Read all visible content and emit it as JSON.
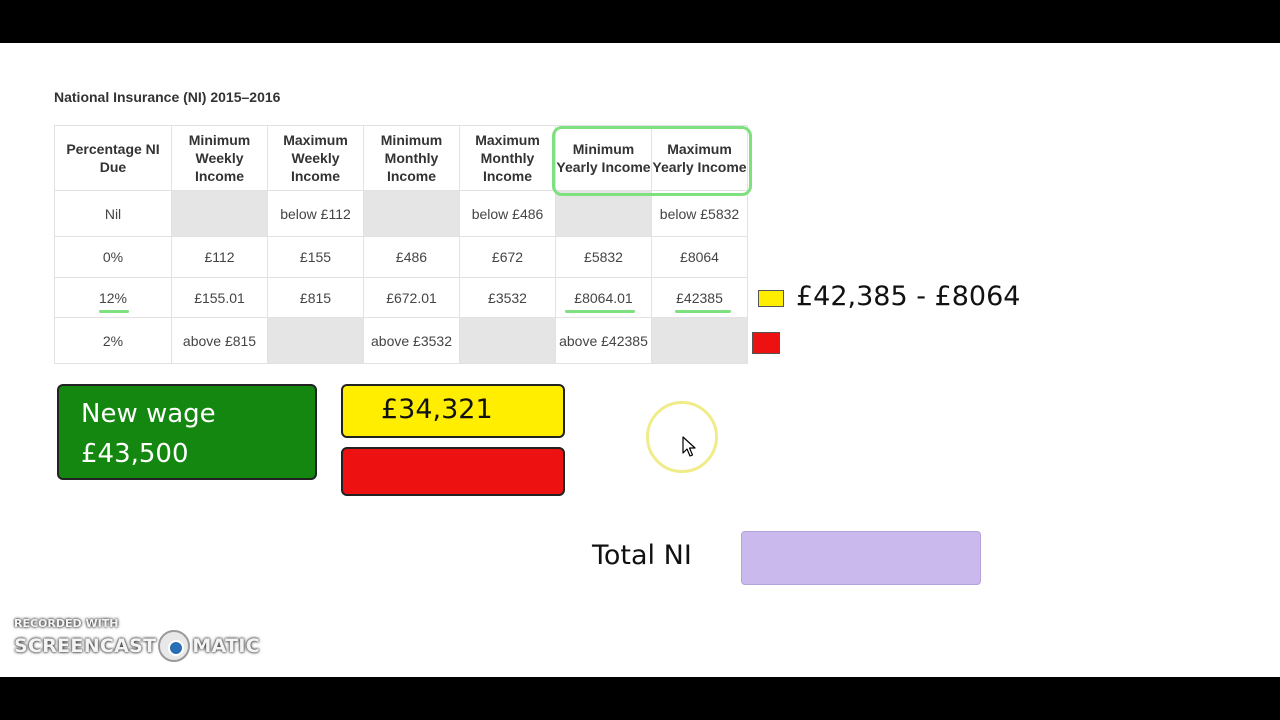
{
  "title": "National Insurance (NI) 2015–2016",
  "table": {
    "headers": [
      "Percentage NI Due",
      "Minimum Weekly Income",
      "Maximum Weekly Income",
      "Minimum Monthly Income",
      "Maximum Monthly Income",
      "Minimum Yearly Income",
      "Maximum Yearly Income"
    ],
    "rows": [
      [
        "Nil",
        "",
        "below £112",
        "",
        "below £486",
        "",
        "below £5832"
      ],
      [
        "0%",
        "£112",
        "£155",
        "£486",
        "£672",
        "£5832",
        "£8064"
      ],
      [
        "12%",
        "£155.01",
        "£815",
        "£672.01",
        "£3532",
        "£8064.01",
        "£42385"
      ],
      [
        "2%",
        "above £815",
        "",
        "above £3532",
        "",
        "above £42385",
        ""
      ]
    ]
  },
  "key": {
    "yellow_label": "£42,385 - £8064",
    "yellow_color": "#ffee00",
    "red_color": "#ee1111"
  },
  "new_wage": {
    "line1": "New wage",
    "line2": "£43,500"
  },
  "yellow_result": "£34,321",
  "total_ni_label": "Total NI",
  "watermark": {
    "small": "RECORDED WITH",
    "left": "SCREENCAST",
    "right": "MATIC"
  }
}
